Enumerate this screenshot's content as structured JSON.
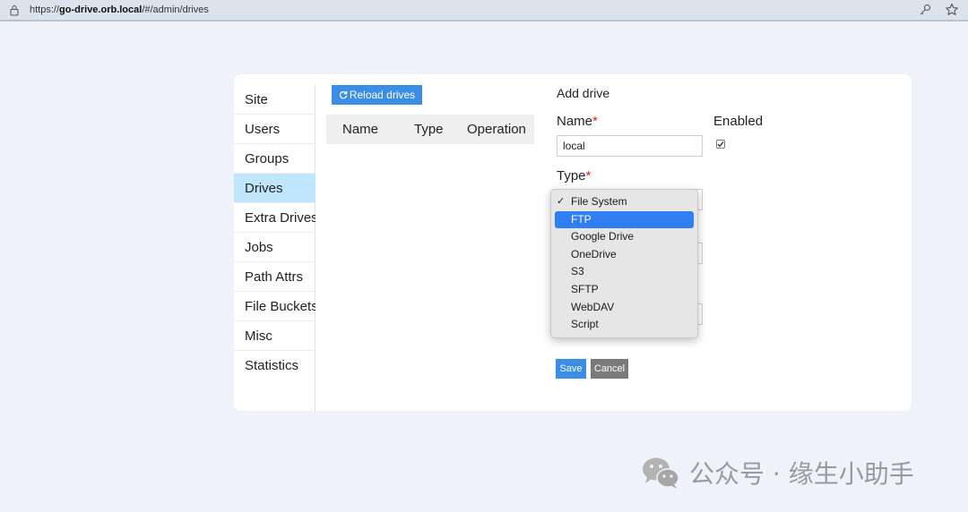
{
  "browser": {
    "url_prefix": "https://",
    "url_host": "go-drive.orb.local",
    "url_path": "/#/admin/drives"
  },
  "sidebar": {
    "items": [
      {
        "label": "Site"
      },
      {
        "label": "Users"
      },
      {
        "label": "Groups"
      },
      {
        "label": "Drives",
        "active": true
      },
      {
        "label": "Extra Drives"
      },
      {
        "label": "Jobs"
      },
      {
        "label": "Path Attrs"
      },
      {
        "label": "File Buckets"
      },
      {
        "label": "Misc"
      },
      {
        "label": "Statistics"
      }
    ]
  },
  "drives": {
    "reload_label": "Reload drives",
    "columns": [
      "Name",
      "Type",
      "Operation"
    ]
  },
  "form": {
    "title": "Add drive",
    "name_label": "Name",
    "name_value": "local",
    "enabled_label": "Enabled",
    "enabled_checked": true,
    "type_label": "Type",
    "required_mark": "*",
    "type_options": [
      {
        "label": "File System",
        "selected": true
      },
      {
        "label": "FTP",
        "highlighted": true
      },
      {
        "label": "Google Drive"
      },
      {
        "label": "OneDrive"
      },
      {
        "label": "S3"
      },
      {
        "label": "SFTP"
      },
      {
        "label": "WebDAV"
      },
      {
        "label": "Script"
      }
    ],
    "save_label": "Save",
    "cancel_label": "Cancel"
  },
  "watermark": {
    "text": "公众号 · 缘生小助手",
    "icon": "wechat-icon"
  },
  "colors": {
    "accent": "#3a8ee6",
    "active_nav": "#bfe6fb",
    "highlight": "#2f7ff2",
    "required": "#e02020"
  }
}
